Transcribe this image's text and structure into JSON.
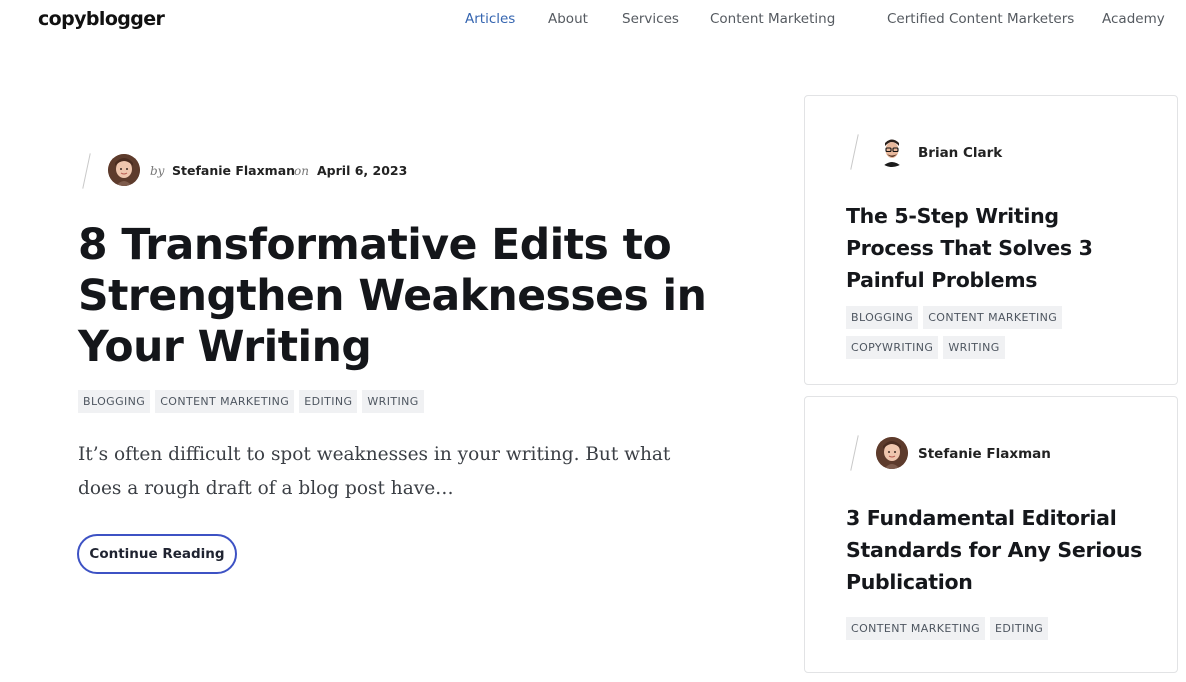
{
  "header": {
    "logo": "copyblogger",
    "nav": [
      {
        "label": "Articles",
        "active": true
      },
      {
        "label": "About",
        "active": false
      },
      {
        "label": "Services",
        "active": false
      },
      {
        "label": "Content Marketing",
        "active": false
      },
      {
        "label": "Certified Content Marketers",
        "active": false
      },
      {
        "label": "Academy",
        "active": false
      }
    ]
  },
  "featured": {
    "by": "by",
    "author": "Stefanie Flaxman",
    "on": "on",
    "date": "April 6, 2023",
    "title": "8 Transformative Edits to Strengthen Weaknesses in Your Writing",
    "tags": [
      "BLOGGING",
      "CONTENT MARKETING",
      "EDITING",
      "WRITING"
    ],
    "excerpt": "It’s often difficult to spot weaknesses in your writing. But what does a rough draft of a blog post have…",
    "cta": "Continue Reading"
  },
  "sidebar": {
    "cards": [
      {
        "author": "Brian Clark",
        "title": "The 5-Step Writing Process That Solves 3 Painful Problems",
        "tags": [
          "BLOGGING",
          "CONTENT MARKETING",
          "COPYWRITING",
          "WRITING"
        ]
      },
      {
        "author": "Stefanie Flaxman",
        "title": "3 Fundamental Editorial Standards for Any Serious Publication",
        "tags": [
          "CONTENT MARKETING",
          "EDITING"
        ]
      }
    ]
  },
  "colors": {
    "accent": "#3565b0",
    "button_border": "#3d52c4",
    "tag_bg": "#f0f1f3"
  }
}
